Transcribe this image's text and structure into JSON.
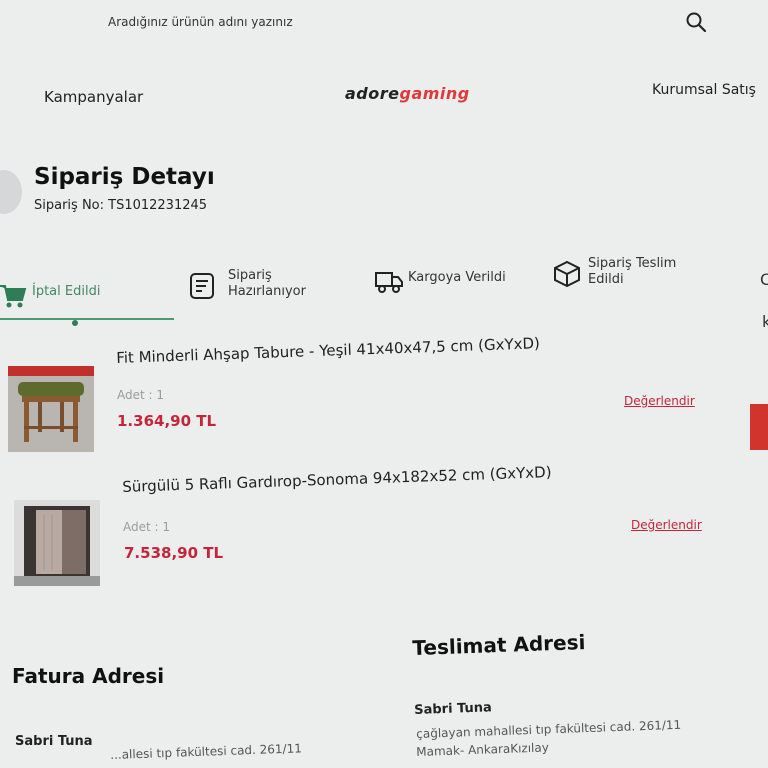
{
  "header": {
    "search_placeholder": "Aradığınız ürünün adını yazınız",
    "nav_left": "Kampanyalar",
    "logo_part1": "adore",
    "logo_part2": "gaming",
    "nav_right": "Kurumsal Satış"
  },
  "order": {
    "title": "Sipariş Detayı",
    "number": "Sipariş No: TS1012231245"
  },
  "steps": [
    {
      "label": "İptal Edildi"
    },
    {
      "label": "Sipariş Hazırlanıyor"
    },
    {
      "label": "Kargoya Verildi"
    },
    {
      "label": "Sipariş Teslim Edildi"
    }
  ],
  "products": [
    {
      "name": "Fit Minderli Ahşap Tabure - Yeşil 41x40x47,5 cm (GxYxD)",
      "qty": "Adet : 1",
      "price": "1.364,90 TL",
      "rate_label": "Değerlendir"
    },
    {
      "name": "Sürgülü 5 Raflı Gardırop-Sonoma 94x182x52 cm (GxYxD)",
      "qty": "Adet : 1",
      "price": "7.538,90 TL",
      "rate_label": "Değerlendir"
    }
  ],
  "billing": {
    "title": "Fatura Adresi",
    "name": "Sabri Tuna",
    "line1": "...allesi tıp fakültesi cad. 261/11"
  },
  "shipping": {
    "title": "Teslimat Adresi",
    "name": "Sabri Tuna",
    "line1": "çağlayan mahallesi tıp fakültesi cad. 261/11",
    "line2": "Mamak- AnkaraKızılay"
  },
  "colors": {
    "accent_red": "#c4253a",
    "progress_green": "#4a9a73"
  }
}
